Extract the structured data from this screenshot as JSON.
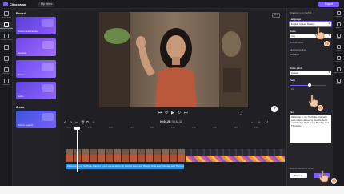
{
  "app": {
    "brand": "Clipchamp",
    "video_tab": "My video",
    "export_label": "Export"
  },
  "left_rail": [
    {
      "icon": "record-icon",
      "label": "Your media"
    },
    {
      "icon": "camera-icon",
      "label": "Record & create"
    },
    {
      "icon": "content-library-icon",
      "label": "Content library"
    },
    {
      "icon": "templates-icon",
      "label": "Templates"
    },
    {
      "icon": "text-icon",
      "label": "Text"
    },
    {
      "icon": "transitions-icon",
      "label": "Transitions"
    },
    {
      "icon": "brand-kit-icon",
      "label": "Brand kit"
    }
  ],
  "record_panel": {
    "heading": "Record",
    "cards": [
      "Screen and camera",
      "Camera",
      "Screen",
      "Audio"
    ],
    "create_heading": "Create",
    "tts_card": "Text to speech"
  },
  "stage": {
    "ratio": "16:9",
    "help": "?"
  },
  "player": {
    "timecode_current": "00:01.25",
    "timecode_total": "00:43.11"
  },
  "timeline": {
    "ruler": [
      "0:00",
      "0:05",
      "0:10",
      "0:15",
      "0:20",
      "0:25",
      "0:30",
      "0:35",
      "0:40",
      "0:45"
    ],
    "tts_clip": "Welcome to my YouTube channel. I post videos about my favorite decor and lifestyle finds every Monday and Thursday."
  },
  "props": {
    "header": "Welcome to my YouTub...",
    "language_label": "Language",
    "language_value": "English (United States)",
    "voice_label": "Voice",
    "voice_value": "Ava",
    "more_voices": "View all voices",
    "advanced_label": "Advanced settings",
    "emotion_label": "Emotion",
    "pitch_label": "Voice pitch",
    "pitch_value": "Default",
    "pace_label": "Pace",
    "pace_value": "1.0x",
    "text_label": "Text",
    "text_value": "Welcome to my YouTube channel. I post videos about my favorite decor and lifestyle finds every Monday and Thursday.",
    "max_duration": "Maximum duration is 10 min",
    "preview_label": "Preview",
    "save_label": "Save",
    "pace_level": 0.55
  },
  "right_rail": [
    {
      "icon": "captions-icon",
      "label": "Captions"
    },
    {
      "icon": "audio-icon",
      "label": "Audio"
    },
    {
      "icon": "fade-icon",
      "label": "Fade"
    },
    {
      "icon": "filters-icon",
      "label": "Filters"
    },
    {
      "icon": "effects-icon",
      "label": "Effects"
    },
    {
      "icon": "adjust-colors-icon",
      "label": "Adjust colors"
    },
    {
      "icon": "speed-icon",
      "label": "Speed"
    }
  ],
  "tutorial_steps": [
    "1",
    "2",
    "3"
  ],
  "colors": {
    "accent": "#7c5cff",
    "tts_track": "#2f8fd8",
    "step": "#ff8a3d"
  }
}
